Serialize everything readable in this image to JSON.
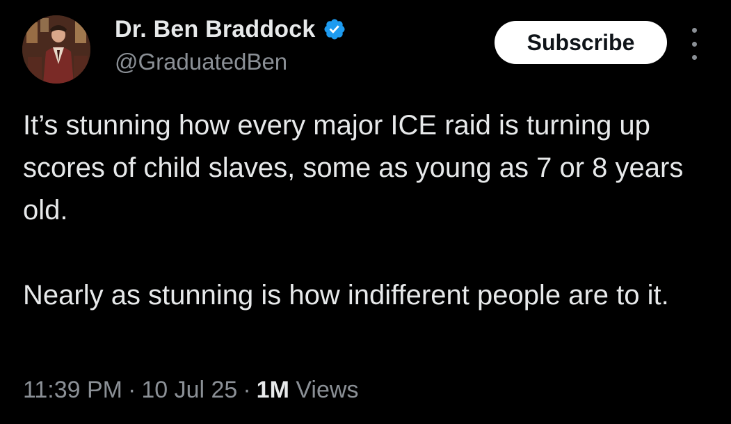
{
  "colors": {
    "background": "#000000",
    "primary_text": "#e7e9ea",
    "secondary_text": "#8b9096",
    "verified_badge": "#1d9bf0",
    "subscribe_bg": "#ffffff"
  },
  "author": {
    "display_name": "Dr. Ben Braddock",
    "handle": "@GraduatedBen",
    "verified": true,
    "verified_icon": "verified-badge-icon",
    "avatar": "profile-avatar"
  },
  "actions": {
    "subscribe_label": "Subscribe",
    "more_icon": "more-vertical-icon"
  },
  "tweet": {
    "paragraphs": [
      "It’s stunning how every major ICE raid is turning up scores of child slaves, some as young as 7 or 8 years old.",
      "Nearly as stunning is how indifferent people are to it."
    ]
  },
  "meta": {
    "time": "11:39 PM",
    "separator": "·",
    "date": "10 Jul 25",
    "views_count": "1M",
    "views_label": "Views"
  }
}
